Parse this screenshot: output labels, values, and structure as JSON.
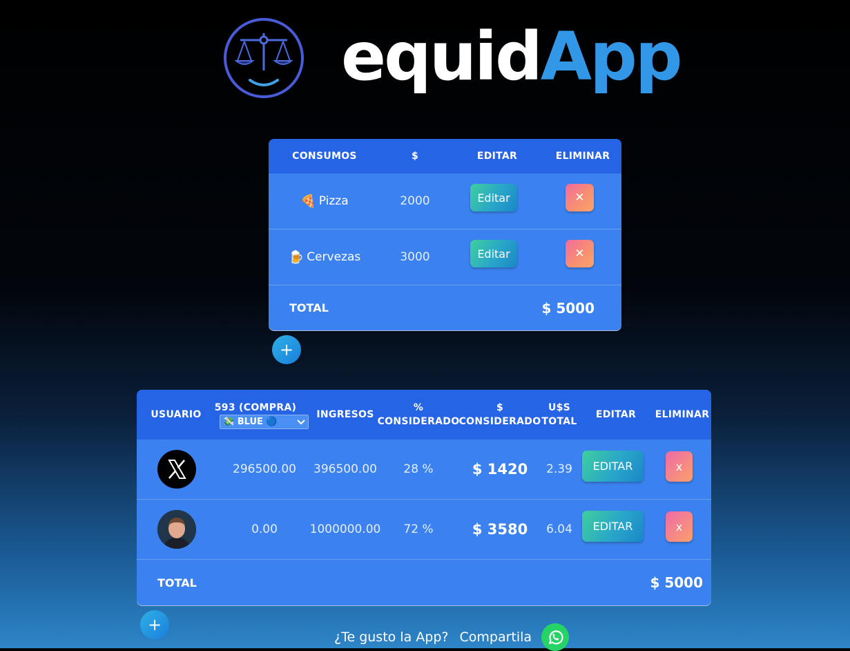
{
  "brand": {
    "part1": "equid",
    "part2": "App",
    "logo_icon": "balance-scale-smile-icon"
  },
  "consumos": {
    "headers": [
      "CONSUMOS",
      "$",
      "EDITAR",
      "ELIMINAR"
    ],
    "rows": [
      {
        "emoji": "🍕",
        "name": "Pizza",
        "amount": "2000",
        "edit_label": "Editar",
        "delete_label": "✕"
      },
      {
        "emoji": "🍺",
        "name": "Cervezas",
        "amount": "3000",
        "edit_label": "Editar",
        "delete_label": "✕"
      }
    ],
    "total_label": "TOTAL",
    "total_value": "$ 5000",
    "add_label": "+"
  },
  "usuarios": {
    "headers": {
      "usuario": "USUARIO",
      "rate": "593 (COMPRA)",
      "rate_select": "💸 BLUE 🔵",
      "ingresos": "INGRESOS",
      "pct_1": "%",
      "pct_2": "CONSIDERADO",
      "amt_1": "$",
      "amt_2": "CONSIDERADO",
      "usd_1": "U$S",
      "usd_2": "TOTAL",
      "editar": "EDITAR",
      "eliminar": "ELIMINAR"
    },
    "rows": [
      {
        "avatar": "x-logo-avatar",
        "rate_value": "296500.00",
        "ingresos": "396500.00",
        "pct": "28 %",
        "amount": "$ 1420",
        "usd": "2.39",
        "edit_label": "EDITAR",
        "delete_label": "x"
      },
      {
        "avatar": "person-photo-avatar",
        "rate_value": "0.00",
        "ingresos": "1000000.00",
        "pct": "72 %",
        "amount": "$ 3580",
        "usd": "6.04",
        "edit_label": "EDITAR",
        "delete_label": "x"
      }
    ],
    "total_label": "TOTAL",
    "total_value": "$ 5000",
    "add_label": "+"
  },
  "footer": {
    "question": "¿Te gusto la App?",
    "share": "Compartila",
    "share_icon": "whatsapp-icon"
  },
  "colors": {
    "card": "#3b82f0",
    "header": "#2664e6",
    "accent": "#3397e8",
    "whatsapp": "#25d366"
  }
}
